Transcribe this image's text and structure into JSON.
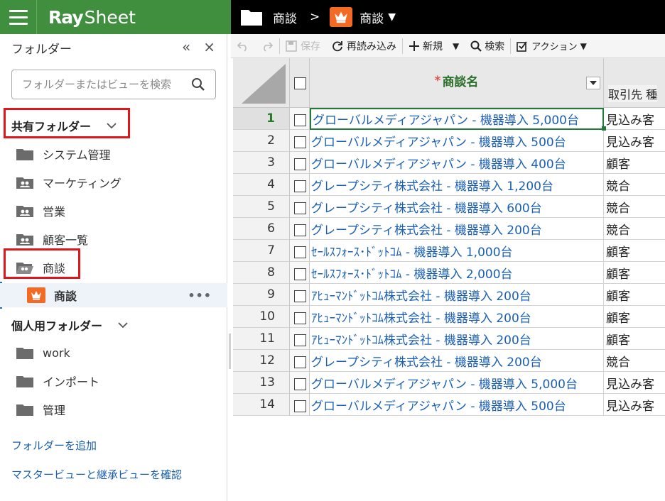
{
  "app": {
    "logo_ray": "Ray",
    "logo_sheet": "Sheet"
  },
  "sidebar": {
    "title": "フォルダー",
    "collapse_label": "«",
    "close_label": "×",
    "search_placeholder": "フォルダーまたはビューを検索",
    "shared_group": "共有フォルダー",
    "shared_items": [
      {
        "label": "システム管理",
        "icon": "folder-icon"
      },
      {
        "label": "マーケティング",
        "icon": "shared-folder-icon"
      },
      {
        "label": "営業",
        "icon": "shared-folder-icon"
      },
      {
        "label": "顧客一覧",
        "icon": "shared-folder-icon"
      },
      {
        "label": "商談",
        "icon": "shared-folder-open-icon"
      }
    ],
    "selected_view": {
      "label": "商談",
      "more": "•••"
    },
    "personal_group": "個人用フォルダー",
    "personal_items": [
      {
        "label": "work"
      },
      {
        "label": "インポート"
      },
      {
        "label": "管理"
      }
    ],
    "add_folder_link": "フォルダーを追加",
    "master_view_link": "マスタービューと継承ビューを確認"
  },
  "breadcrumb": {
    "folder": "商談",
    "separator": ">",
    "view": "商談"
  },
  "toolbar": {
    "save": "保存",
    "reload": "再読み込み",
    "new": "新規",
    "search": "検索",
    "action": "アクション"
  },
  "grid": {
    "name_header": "商談名",
    "required_mark": "*",
    "account_header": "取引先 種",
    "rows": [
      {
        "num": "1",
        "name": "グローバルメディアジャパン - 機器導入 5,000台",
        "acc": "見込み客"
      },
      {
        "num": "2",
        "name": "グローバルメディアジャパン - 機器導入 500台",
        "acc": "見込み客"
      },
      {
        "num": "3",
        "name": "グローバルメディアジャパン - 機器導入 400台",
        "acc": "顧客"
      },
      {
        "num": "4",
        "name": "グレープシティ株式会社 - 機器導入 1,200台",
        "acc": "競合"
      },
      {
        "num": "5",
        "name": "グレープシティ株式会社 - 機器導入 600台",
        "acc": "競合"
      },
      {
        "num": "6",
        "name": "グレープシティ株式会社 - 機器導入 200台",
        "acc": "競合"
      },
      {
        "num": "7",
        "name": "ｾｰﾙｽﾌｫｰｽ･ﾄﾞｯﾄｺﾑ - 機器導入 1,000台",
        "acc": "顧客"
      },
      {
        "num": "8",
        "name": "ｾｰﾙｽﾌｫｰｽ･ﾄﾞｯﾄｺﾑ - 機器導入 2,000台",
        "acc": "顧客"
      },
      {
        "num": "9",
        "name": "ｱﾋｭｰﾏﾝﾄﾞｯﾄｺﾑ株式会社 - 機器導入 200台",
        "acc": "顧客"
      },
      {
        "num": "10",
        "name": "ｱﾋｭｰﾏﾝﾄﾞｯﾄｺﾑ株式会社 - 機器導入 200台",
        "acc": "顧客"
      },
      {
        "num": "11",
        "name": "ｱﾋｭｰﾏﾝﾄﾞｯﾄｺﾑ株式会社 - 機器導入 200台",
        "acc": "顧客"
      },
      {
        "num": "12",
        "name": "グレープシティ株式会社 - 機器導入 200台",
        "acc": "競合"
      },
      {
        "num": "13",
        "name": "グローバルメディアジャパン - 機器導入 5,000台",
        "acc": "見込み客"
      },
      {
        "num": "14",
        "name": "グローバルメディアジャパン - 機器導入 500台",
        "acc": "見込み客"
      }
    ]
  },
  "colors": {
    "brand_green": "#3f8f3e",
    "highlight_red": "#e0171a",
    "crown_orange": "#f26a24",
    "link_blue": "#1a5fb4"
  }
}
